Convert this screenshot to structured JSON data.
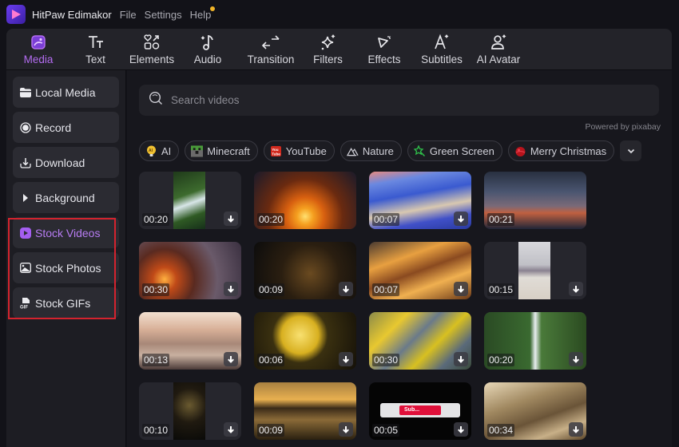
{
  "titlebar": {
    "app_name": "HitPaw Edimakor",
    "menus": [
      "File",
      "Settings",
      "Help"
    ]
  },
  "toolbar": {
    "tabs": [
      {
        "label": "Media",
        "icon": "media-icon",
        "active": true
      },
      {
        "label": "Text",
        "icon": "text-icon",
        "active": false
      },
      {
        "label": "Elements",
        "icon": "elements-icon",
        "active": false
      },
      {
        "label": "Audio",
        "icon": "audio-icon",
        "active": false
      },
      {
        "label": "Transition",
        "icon": "transition-icon",
        "active": false
      },
      {
        "label": "Filters",
        "icon": "filters-icon",
        "active": false
      },
      {
        "label": "Effects",
        "icon": "effects-icon",
        "active": false
      },
      {
        "label": "Subtitles",
        "icon": "subtitles-icon",
        "active": false
      },
      {
        "label": "AI Avatar",
        "icon": "ai-avatar-icon",
        "active": false
      }
    ]
  },
  "sidebar": {
    "items": [
      {
        "label": "Local Media",
        "icon": "folder-icon",
        "active": false
      },
      {
        "label": "Record",
        "icon": "record-icon",
        "active": false
      },
      {
        "label": "Download",
        "icon": "download-icon",
        "active": false
      },
      {
        "label": "Background",
        "icon": "triangle-right-icon",
        "active": false
      },
      {
        "label": "Stock Videos",
        "icon": "play-icon",
        "active": true
      },
      {
        "label": "Stock Photos",
        "icon": "image-icon",
        "active": false
      },
      {
        "label": "Stock GIFs",
        "icon": "gif-icon",
        "active": false
      }
    ]
  },
  "search": {
    "placeholder": "Search videos",
    "value": "",
    "powered_by": "Powered by pixabay"
  },
  "chips": [
    {
      "label": "AI",
      "icon": "ai-bulb-icon"
    },
    {
      "label": "Minecraft",
      "icon": "minecraft-icon"
    },
    {
      "label": "YouTube",
      "icon": "youtube-icon"
    },
    {
      "label": "Nature",
      "icon": "mountain-icon"
    },
    {
      "label": "Green Screen",
      "icon": "green-screen-icon"
    },
    {
      "label": "Merry Christmas",
      "icon": "christmas-ornament-icon"
    }
  ],
  "colors": {
    "accent": "#b36cf0",
    "highlight_box": "#d4232e"
  },
  "videos": [
    {
      "duration": "00:20",
      "scene": "forest waterfall stream",
      "orientation": "portrait",
      "download": true
    },
    {
      "duration": "00:20",
      "scene": "birds at sunset over sea",
      "orientation": "landscape",
      "download": false
    },
    {
      "duration": "00:07",
      "scene": "blue pebble beach",
      "orientation": "landscape",
      "download": true
    },
    {
      "duration": "00:21",
      "scene": "dusk sunset clouds",
      "orientation": "landscape",
      "download": false
    },
    {
      "duration": "00:30",
      "scene": "christmas fireplace room",
      "orientation": "landscape",
      "download": true
    },
    {
      "duration": "00:09",
      "scene": "2024 to 2025 fireworks",
      "orientation": "landscape",
      "download": true
    },
    {
      "duration": "00:07",
      "scene": "golden sunset sky",
      "orientation": "landscape",
      "download": true
    },
    {
      "duration": "00:15",
      "scene": "horses running in desert",
      "orientation": "portrait",
      "download": true
    },
    {
      "duration": "00:13",
      "scene": "open book on beach",
      "orientation": "landscape",
      "download": true
    },
    {
      "duration": "00:06",
      "scene": "full moon with tree",
      "orientation": "landscape",
      "download": true
    },
    {
      "duration": "00:30",
      "scene": "yellow leaves over stream",
      "orientation": "landscape",
      "download": true
    },
    {
      "duration": "00:20",
      "scene": "jungle waterfall",
      "orientation": "landscape",
      "download": true
    },
    {
      "duration": "00:10",
      "scene": "2025 gold sparkles",
      "orientation": "portrait",
      "download": true
    },
    {
      "duration": "00:09",
      "scene": "golden sea sunset",
      "orientation": "landscape",
      "download": true
    },
    {
      "duration": "00:05",
      "scene": "subscribe button",
      "orientation": "landscape",
      "download": true,
      "overlay_text": "Sub..."
    },
    {
      "duration": "00:34",
      "scene": "misty sepia forest",
      "orientation": "landscape",
      "download": true
    }
  ]
}
